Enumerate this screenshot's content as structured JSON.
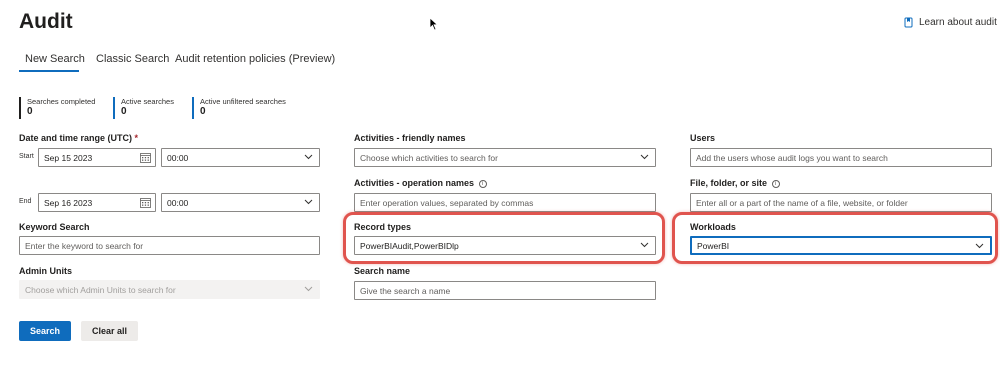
{
  "header": {
    "title": "Audit",
    "learn_link": "Learn about audit",
    "learn_icon": "document-icon"
  },
  "tabs": [
    {
      "label": "New Search",
      "active": true
    },
    {
      "label": "Classic Search",
      "active": false
    },
    {
      "label": "Audit retention policies (Preview)",
      "active": false
    }
  ],
  "stats": [
    {
      "label": "Searches completed",
      "value": "0",
      "color": "#201f1e"
    },
    {
      "label": "Active searches",
      "value": "0",
      "color": "#0f6cbd"
    },
    {
      "label": "Active unfiltered searches",
      "value": "0",
      "color": "#0f6cbd"
    }
  ],
  "date_range": {
    "label": "Date and time range (UTC)",
    "required_mark": "*",
    "start_label": "Start",
    "start_date": "Sep 15 2023",
    "start_time": "00:00",
    "end_label": "End",
    "end_date": "Sep 16 2023",
    "end_time": "00:00"
  },
  "keyword": {
    "label": "Keyword Search",
    "placeholder": "Enter the keyword to search for"
  },
  "admin_units": {
    "label": "Admin Units",
    "placeholder": "Choose which Admin Units to search for"
  },
  "activities_friendly": {
    "label": "Activities - friendly names",
    "placeholder": "Choose which activities to search for"
  },
  "activities_operation": {
    "label": "Activities - operation names",
    "placeholder": "Enter operation values, separated by commas"
  },
  "record_types": {
    "label": "Record types",
    "value": "PowerBIAudit,PowerBIDlp"
  },
  "search_name": {
    "label": "Search name",
    "placeholder": "Give the search a name"
  },
  "users": {
    "label": "Users",
    "placeholder": "Add the users whose audit logs you want to search"
  },
  "file_folder": {
    "label": "File, folder, or site",
    "placeholder": "Enter all or a part of the name of a file, website, or folder"
  },
  "workloads": {
    "label": "Workloads",
    "value": "PowerBI"
  },
  "buttons": {
    "search": "Search",
    "clear": "Clear all"
  },
  "colors": {
    "accent": "#0f6cbd",
    "highlight": "#e0544e"
  }
}
